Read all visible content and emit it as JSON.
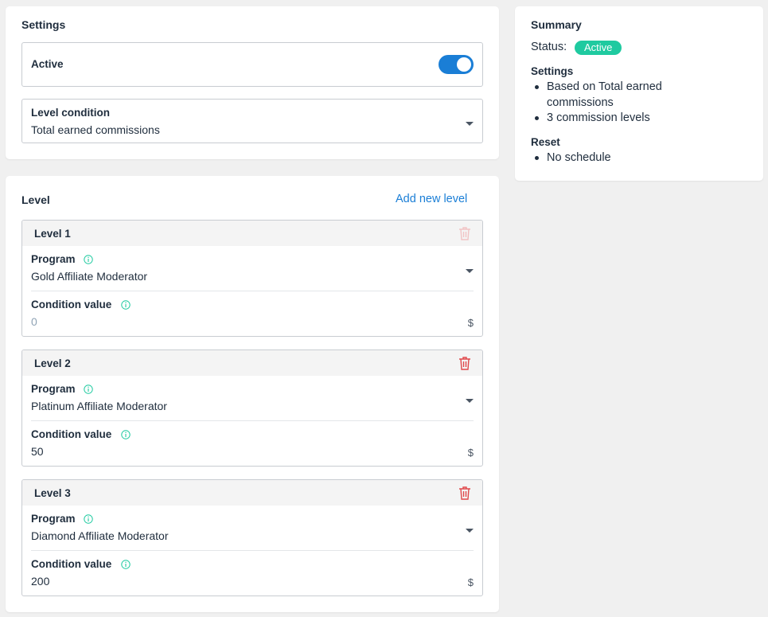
{
  "settings": {
    "title": "Settings",
    "active_label": "Active",
    "active_on": true,
    "level_condition_label": "Level condition",
    "level_condition_value": "Total earned commissions"
  },
  "levels_section": {
    "title": "Level",
    "add_label": "Add new level",
    "program_label": "Program",
    "condition_label": "Condition value",
    "currency": "$",
    "items": [
      {
        "title": "Level 1",
        "program": "Gold Affiliate Moderator",
        "condition_value": "0"
      },
      {
        "title": "Level 2",
        "program": "Platinum Affiliate Moderator",
        "condition_value": "50"
      },
      {
        "title": "Level 3",
        "program": "Diamond Affiliate Moderator",
        "condition_value": "200"
      }
    ]
  },
  "summary": {
    "title": "Summary",
    "status_label": "Status:",
    "status_badge": "Active",
    "settings_heading": "Settings",
    "settings_items": [
      "Based on Total earned",
      "commissions",
      "3 commission levels"
    ],
    "reset_heading": "Reset",
    "reset_items": [
      "No schedule"
    ]
  },
  "colors": {
    "accent": "#1a7ed6",
    "badge": "#1fcaa0",
    "trash_active": "#e0484b",
    "trash_disabled": "#f2c4c5",
    "info": "#1fcaa0"
  },
  "icons": {
    "trash": "trash-icon",
    "info": "info-icon",
    "caret": "chevron-down-icon"
  }
}
